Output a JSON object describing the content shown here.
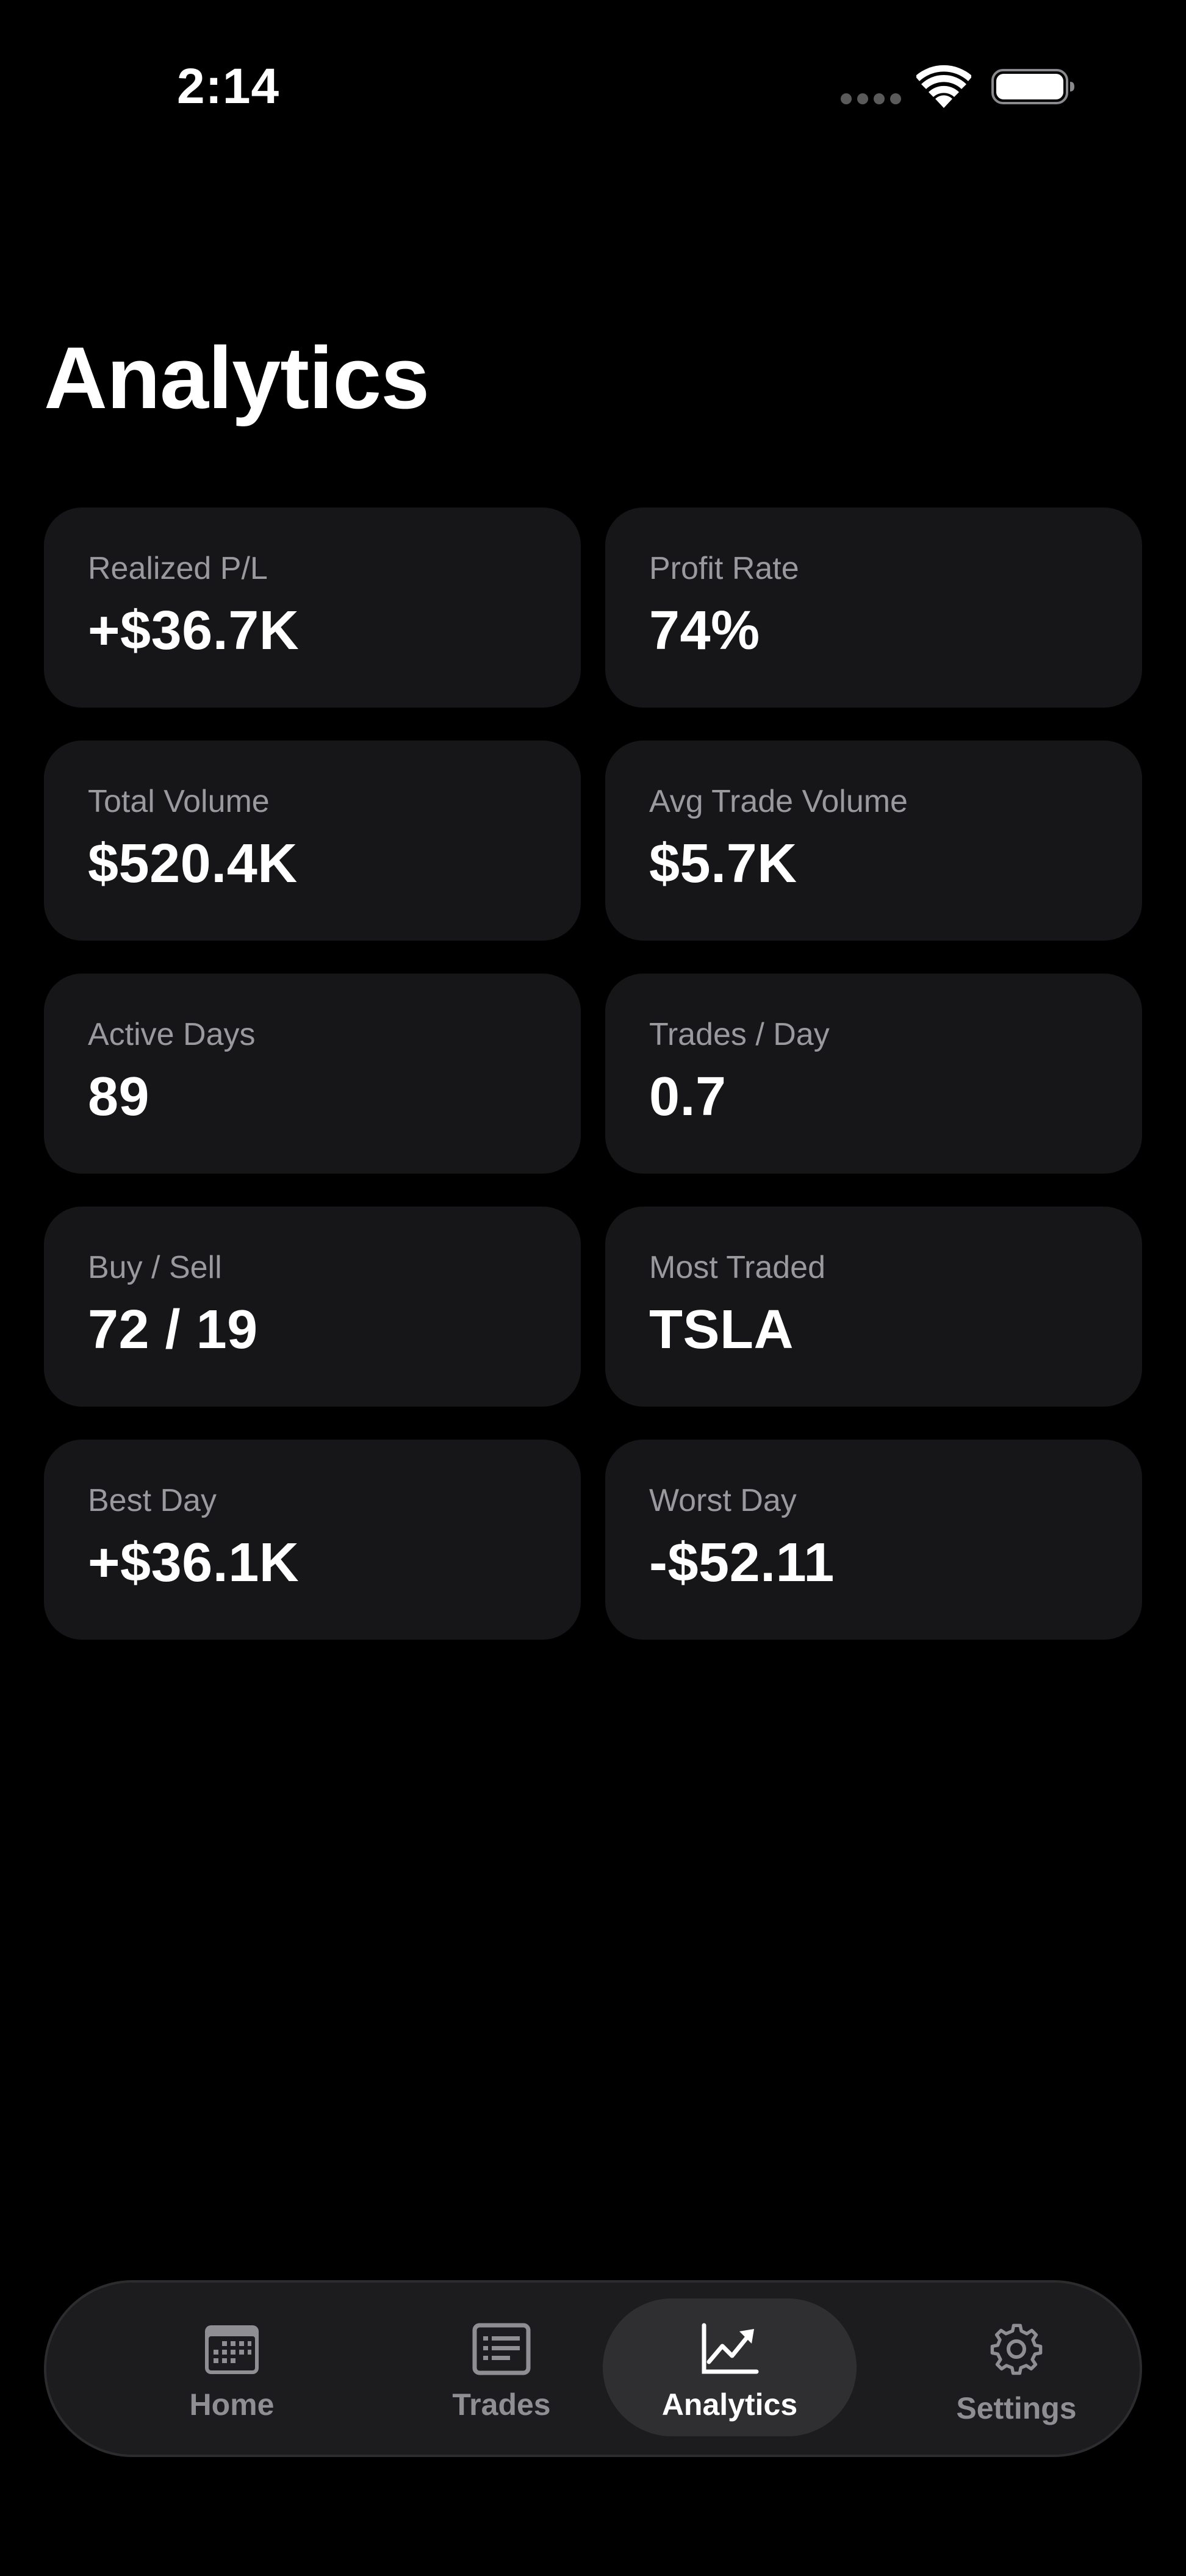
{
  "status_bar": {
    "time": "2:14",
    "icons": [
      "signal-dots-icon",
      "wifi-icon",
      "battery-icon"
    ]
  },
  "page": {
    "title": "Analytics"
  },
  "stats": [
    {
      "label": "Realized P/L",
      "value": "+$36.7K"
    },
    {
      "label": "Profit Rate",
      "value": "74%"
    },
    {
      "label": "Total Volume",
      "value": "$520.4K"
    },
    {
      "label": "Avg Trade Volume",
      "value": "$5.7K"
    },
    {
      "label": "Active Days",
      "value": "89"
    },
    {
      "label": "Trades / Day",
      "value": "0.7"
    },
    {
      "label": "Buy / Sell",
      "value": "72 / 19"
    },
    {
      "label": "Most Traded",
      "value": "TSLA"
    },
    {
      "label": "Best Day",
      "value": "+$36.1K"
    },
    {
      "label": "Worst Day",
      "value": "-$52.11"
    }
  ],
  "tab_bar": {
    "items": [
      {
        "label": "Home",
        "icon": "calendar-icon",
        "active": false
      },
      {
        "label": "Trades",
        "icon": "list-icon",
        "active": false
      },
      {
        "label": "Analytics",
        "icon": "chart-icon",
        "active": true
      },
      {
        "label": "Settings",
        "icon": "gear-icon",
        "active": false
      }
    ]
  },
  "colors": {
    "background": "#000000",
    "card": "#161618",
    "label": "#9a9a9e",
    "tab_inactive": "#8e8e93",
    "tab_active_bg": "#2f2f31"
  }
}
